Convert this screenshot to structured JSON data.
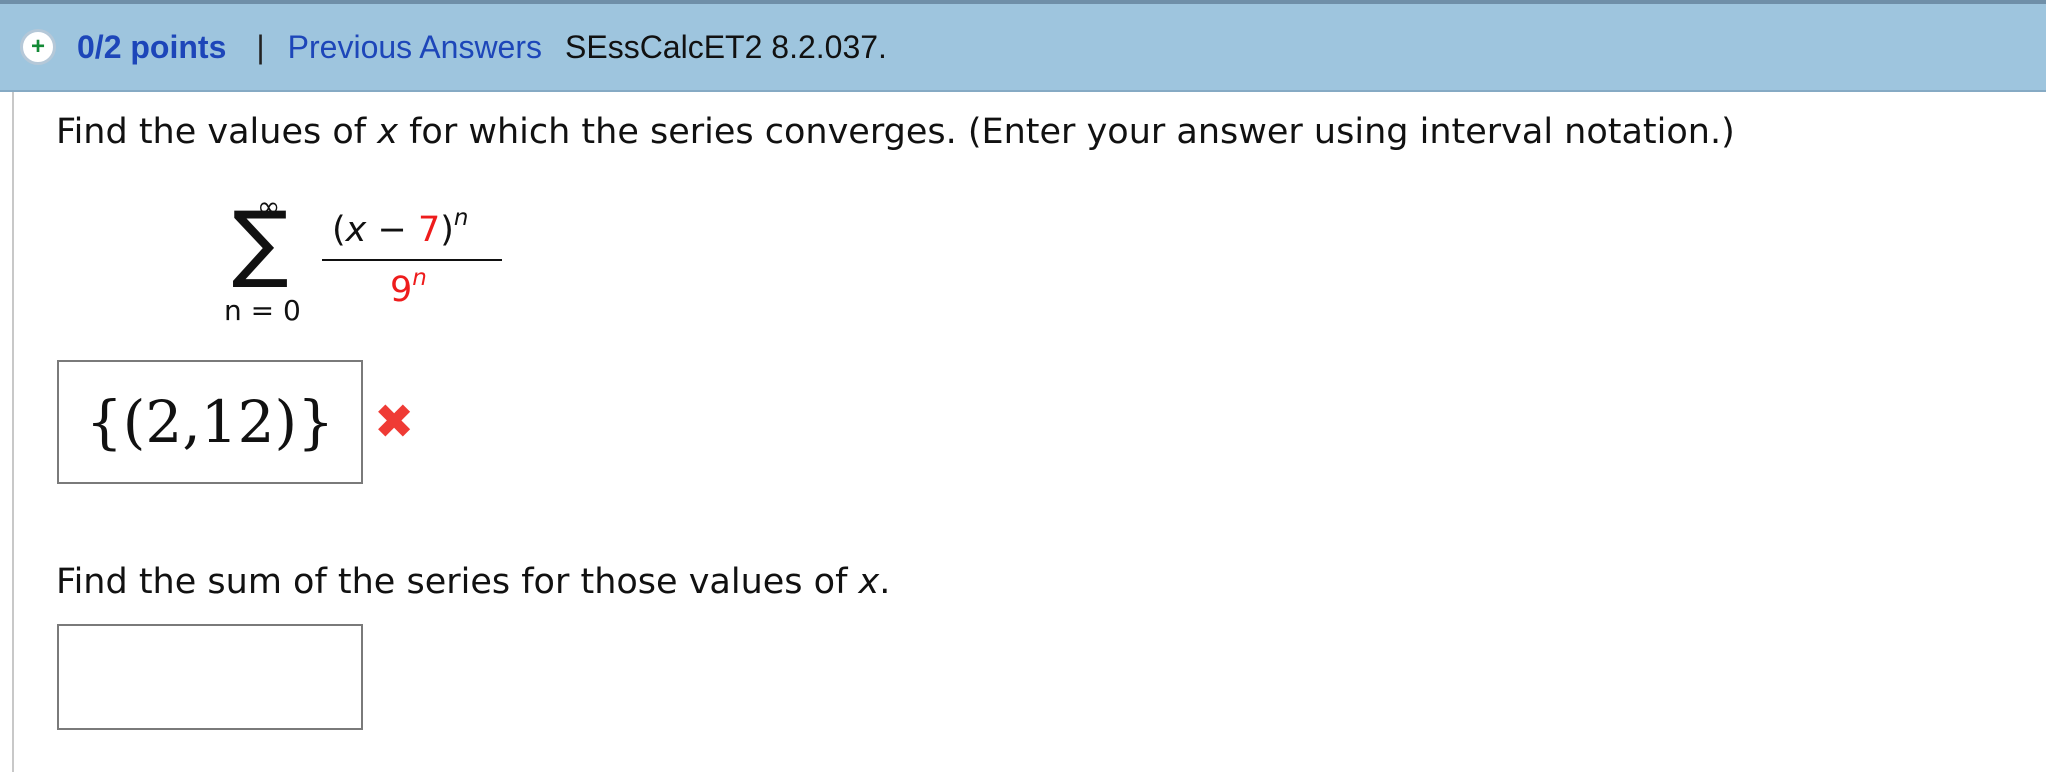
{
  "header": {
    "icon": "plus-circle-icon",
    "points": "0/2 points",
    "separator": "|",
    "previous_answers": "Previous Answers",
    "problem_code": "SEssCalcET2 8.2.037."
  },
  "question_one": {
    "before_variable": "Find the values of ",
    "variable": "x",
    "after_variable": " for which the series converges. (Enter your answer using interval notation.)"
  },
  "series": {
    "summation_symbol": "∑",
    "upper_limit": "∞",
    "lower_limit": "n = 0",
    "numerator_open": "(",
    "numerator_variable": "x",
    "numerator_operator": " − ",
    "numerator_constant": "7",
    "numerator_close": ")",
    "numerator_exponent": "n",
    "denominator_base": "9",
    "denominator_exponent": "n"
  },
  "answer_one": {
    "value": "{(2,12)}",
    "status_icon": "red-x-icon",
    "status_symbol": "✖"
  },
  "question_two": {
    "before_variable": "Find the sum of the series for those values of ",
    "variable": "x",
    "after_variable": "."
  },
  "answer_two": {
    "value": ""
  },
  "colors": {
    "header_background": "#9ec5de",
    "link": "#1d46b9",
    "error": "#ee1c1c",
    "box_border": "#7a7a7a"
  }
}
